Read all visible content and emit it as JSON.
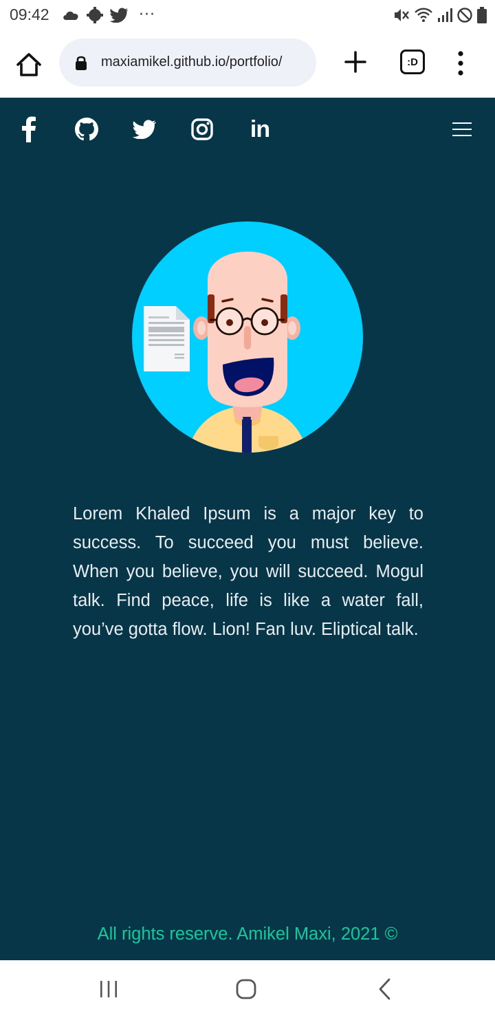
{
  "status": {
    "time": "09:42",
    "left_icons": [
      "cloud-icon",
      "settings-icon",
      "twitter-bird-icon"
    ],
    "more": "···",
    "right_icons": [
      "mute-icon",
      "wifi-icon",
      "signal-icon",
      "no-disturb-icon",
      "battery-icon"
    ]
  },
  "browser": {
    "url": "maxiamikel.github.io/portfolio/",
    "tabs_label": ":D"
  },
  "social": [
    "facebook-icon",
    "github-icon",
    "twitter-icon",
    "instagram-icon",
    "linkedin-icon"
  ],
  "linkedin_glyph": "in",
  "bio": "Lorem Khaled Ipsum is a major key to success. To succeed you must believe. When you believe, you will succeed. Mogul talk. Find peace, life is like a water fall, you’ve gotta flow. Lion! Fan luv. Eliptical talk.",
  "footer": "All rights reserve. Amikel Maxi, 2021 ©",
  "colors": {
    "site_bg": "#073649",
    "avatar_circle": "#00cfff",
    "footer_text": "#18c79c"
  }
}
